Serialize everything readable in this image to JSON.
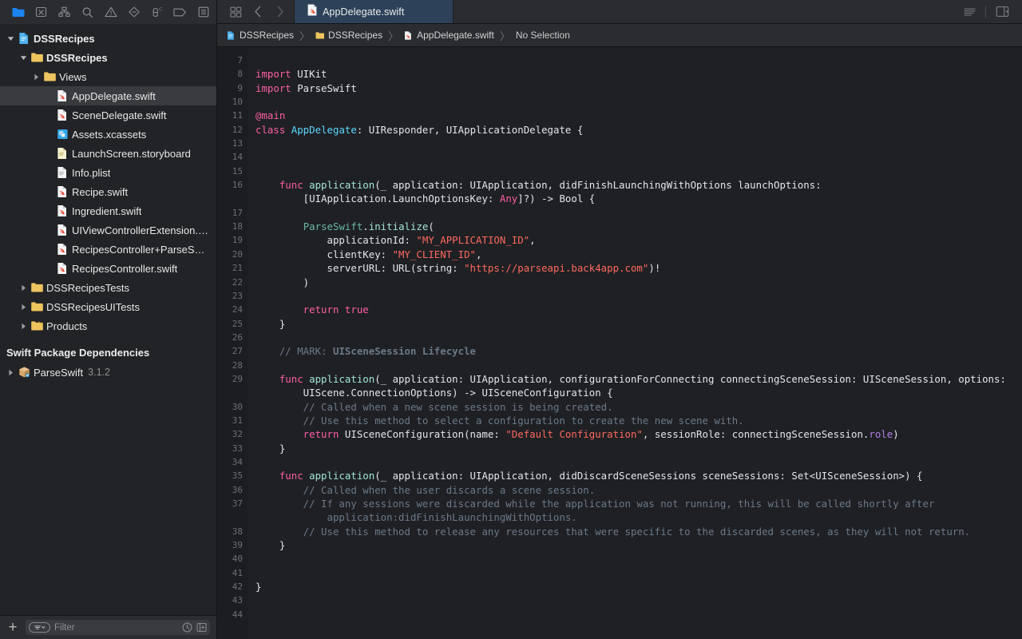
{
  "window": {
    "title": "AppDelegate.swift"
  },
  "navigator_toolbar": {
    "icons": [
      {
        "name": "project-navigator-icon",
        "label": "Project"
      },
      {
        "name": "source-control-navigator-icon",
        "label": "Source Control"
      },
      {
        "name": "symbol-navigator-icon",
        "label": "Symbols"
      },
      {
        "name": "find-navigator-icon",
        "label": "Find"
      },
      {
        "name": "issue-navigator-icon",
        "label": "Issues"
      },
      {
        "name": "test-navigator-icon",
        "label": "Tests"
      },
      {
        "name": "debug-navigator-icon",
        "label": "Debug"
      },
      {
        "name": "breakpoint-navigator-icon",
        "label": "Breakpoints"
      },
      {
        "name": "report-navigator-icon",
        "label": "Reports"
      }
    ]
  },
  "editor_toolbar": {
    "grid_button": "grid-view-icon",
    "back_button": "chevron-left-icon",
    "forward_button": "chevron-right-icon",
    "minimap_button": "minimap-icon",
    "inspector_button": "inspector-toggle-icon"
  },
  "tabs": [
    {
      "label": "AppDelegate.swift",
      "icon": "swift-file-icon",
      "active": true
    }
  ],
  "breadcrumb": [
    {
      "label": "DSSRecipes",
      "icon": "project-icon"
    },
    {
      "label": "DSSRecipes",
      "icon": "folder-icon"
    },
    {
      "label": "AppDelegate.swift",
      "icon": "swift-file-icon"
    },
    {
      "label": "No Selection",
      "icon": null
    }
  ],
  "navigator": {
    "tree": [
      {
        "label": "DSSRecipes",
        "icon": "project-icon",
        "indent": 0,
        "twisty": "down",
        "bold": true,
        "selected": false
      },
      {
        "label": "DSSRecipes",
        "icon": "folder-icon",
        "indent": 1,
        "twisty": "down",
        "bold": true,
        "selected": false
      },
      {
        "label": "Views",
        "icon": "folder-icon",
        "indent": 2,
        "twisty": "right",
        "bold": false,
        "selected": false
      },
      {
        "label": "AppDelegate.swift",
        "icon": "swift-file-icon",
        "indent": 3,
        "twisty": "none",
        "bold": false,
        "selected": true
      },
      {
        "label": "SceneDelegate.swift",
        "icon": "swift-file-icon",
        "indent": 3,
        "twisty": "none",
        "bold": false,
        "selected": false
      },
      {
        "label": "Assets.xcassets",
        "icon": "assets-icon",
        "indent": 3,
        "twisty": "none",
        "bold": false,
        "selected": false
      },
      {
        "label": "LaunchScreen.storyboard",
        "icon": "storyboard-icon",
        "indent": 3,
        "twisty": "none",
        "bold": false,
        "selected": false
      },
      {
        "label": "Info.plist",
        "icon": "plist-icon",
        "indent": 3,
        "twisty": "none",
        "bold": false,
        "selected": false
      },
      {
        "label": "Recipe.swift",
        "icon": "swift-file-icon",
        "indent": 3,
        "twisty": "none",
        "bold": false,
        "selected": false
      },
      {
        "label": "Ingredient.swift",
        "icon": "swift-file-icon",
        "indent": 3,
        "twisty": "none",
        "bold": false,
        "selected": false
      },
      {
        "label": "UIViewControllerExtension.s…",
        "icon": "swift-file-icon",
        "indent": 3,
        "twisty": "none",
        "bold": false,
        "selected": false
      },
      {
        "label": "RecipesController+ParseSwift…",
        "icon": "swift-file-icon",
        "indent": 3,
        "twisty": "none",
        "bold": false,
        "selected": false
      },
      {
        "label": "RecipesController.swift",
        "icon": "swift-file-icon",
        "indent": 3,
        "twisty": "none",
        "bold": false,
        "selected": false
      },
      {
        "label": "DSSRecipesTests",
        "icon": "folder-icon",
        "indent": 1,
        "twisty": "right",
        "bold": false,
        "selected": false
      },
      {
        "label": "DSSRecipesUITests",
        "icon": "folder-icon",
        "indent": 1,
        "twisty": "right",
        "bold": false,
        "selected": false
      },
      {
        "label": "Products",
        "icon": "folder-products-icon",
        "indent": 1,
        "twisty": "right",
        "bold": false,
        "selected": false
      }
    ],
    "packages_section_title": "Swift Package Dependencies",
    "packages": [
      {
        "label": "ParseSwift",
        "version": "3.1.2",
        "icon": "package-icon",
        "indent": 0,
        "twisty": "right"
      }
    ],
    "footer": {
      "add_label": "+",
      "filter_placeholder": "Filter",
      "recent_icon": "clock-icon",
      "sourcecontrol_icon": "filter-scm-icon"
    }
  },
  "editor": {
    "first_line_number": 7,
    "last_line_number": 44,
    "lines": [
      {
        "n": 7,
        "tokens": []
      },
      {
        "n": 8,
        "tokens": [
          {
            "t": "import ",
            "c": "kw"
          },
          {
            "t": "UIKit",
            "c": "plain"
          }
        ]
      },
      {
        "n": 9,
        "tokens": [
          {
            "t": "import ",
            "c": "kw"
          },
          {
            "t": "ParseSwift",
            "c": "plain"
          }
        ]
      },
      {
        "n": 10,
        "tokens": []
      },
      {
        "n": 11,
        "tokens": [
          {
            "t": "@main",
            "c": "attr"
          }
        ]
      },
      {
        "n": 12,
        "tokens": [
          {
            "t": "class ",
            "c": "kw"
          },
          {
            "t": "AppDelegate",
            "c": "tdef"
          },
          {
            "t": ": UIResponder, UIApplicationDelegate {",
            "c": "plain"
          }
        ]
      },
      {
        "n": 13,
        "tokens": []
      },
      {
        "n": 14,
        "tokens": []
      },
      {
        "n": 15,
        "tokens": []
      },
      {
        "n": 16,
        "tokens": [
          {
            "t": "    func ",
            "c": "kw"
          },
          {
            "t": "application",
            "c": "meth"
          },
          {
            "t": "(_ application: UIApplication, didFinishLaunchingWithOptions launchOptions:",
            "c": "plain"
          }
        ]
      },
      {
        "n": null,
        "tokens": [
          {
            "t": "        [UIApplication.LaunchOptionsKey: ",
            "c": "plain"
          },
          {
            "t": "Any",
            "c": "kw"
          },
          {
            "t": "]?) -> Bool {",
            "c": "plain"
          }
        ]
      },
      {
        "n": 17,
        "tokens": []
      },
      {
        "n": 18,
        "tokens": [
          {
            "t": "        ",
            "c": "plain"
          },
          {
            "t": "ParseSwift",
            "c": "fn"
          },
          {
            "t": ".",
            "c": "plain"
          },
          {
            "t": "initialize",
            "c": "meth"
          },
          {
            "t": "(",
            "c": "plain"
          }
        ]
      },
      {
        "n": 19,
        "tokens": [
          {
            "t": "            applicationId: ",
            "c": "plain"
          },
          {
            "t": "\"MY_APPLICATION_ID\"",
            "c": "str"
          },
          {
            "t": ",",
            "c": "plain"
          }
        ]
      },
      {
        "n": 20,
        "tokens": [
          {
            "t": "            clientKey: ",
            "c": "plain"
          },
          {
            "t": "\"MY_CLIENT_ID\"",
            "c": "str"
          },
          {
            "t": ",",
            "c": "plain"
          }
        ]
      },
      {
        "n": 21,
        "tokens": [
          {
            "t": "            serverURL: URL(string: ",
            "c": "plain"
          },
          {
            "t": "\"https://parseapi.back4app.com\"",
            "c": "str"
          },
          {
            "t": ")!",
            "c": "plain"
          }
        ]
      },
      {
        "n": 22,
        "tokens": [
          {
            "t": "        )",
            "c": "plain"
          }
        ]
      },
      {
        "n": 23,
        "tokens": []
      },
      {
        "n": 24,
        "tokens": [
          {
            "t": "        return true",
            "c": "kw"
          }
        ]
      },
      {
        "n": 25,
        "tokens": [
          {
            "t": "    }",
            "c": "plain"
          }
        ]
      },
      {
        "n": 26,
        "tokens": []
      },
      {
        "n": 27,
        "tokens": [
          {
            "t": "    // MARK: ",
            "c": "com"
          },
          {
            "t": "UISceneSession Lifecycle",
            "c": "comk"
          }
        ]
      },
      {
        "n": 28,
        "tokens": []
      },
      {
        "n": 29,
        "tokens": [
          {
            "t": "    func ",
            "c": "kw"
          },
          {
            "t": "application",
            "c": "meth"
          },
          {
            "t": "(_ application: UIApplication, configurationForConnecting connectingSceneSession: UISceneSession, options:",
            "c": "plain"
          }
        ]
      },
      {
        "n": null,
        "tokens": [
          {
            "t": "        UIScene.ConnectionOptions) -> UISceneConfiguration {",
            "c": "plain"
          }
        ]
      },
      {
        "n": 30,
        "tokens": [
          {
            "t": "        // Called when a new scene session is being created.",
            "c": "com"
          }
        ]
      },
      {
        "n": 31,
        "tokens": [
          {
            "t": "        // Use this method to select a configuration to create the new scene with.",
            "c": "com"
          }
        ]
      },
      {
        "n": 32,
        "tokens": [
          {
            "t": "        return ",
            "c": "kw"
          },
          {
            "t": "UISceneConfiguration(name: ",
            "c": "plain"
          },
          {
            "t": "\"Default Configuration\"",
            "c": "str"
          },
          {
            "t": ", sessionRole: connectingSceneSession.",
            "c": "plain"
          },
          {
            "t": "role",
            "c": "prop"
          },
          {
            "t": ")",
            "c": "plain"
          }
        ]
      },
      {
        "n": 33,
        "tokens": [
          {
            "t": "    }",
            "c": "plain"
          }
        ]
      },
      {
        "n": 34,
        "tokens": []
      },
      {
        "n": 35,
        "tokens": [
          {
            "t": "    func ",
            "c": "kw"
          },
          {
            "t": "application",
            "c": "meth"
          },
          {
            "t": "(_ application: UIApplication, didDiscardSceneSessions sceneSessions: Set<UISceneSession>) {",
            "c": "plain"
          }
        ]
      },
      {
        "n": 36,
        "tokens": [
          {
            "t": "        // Called when the user discards a scene session.",
            "c": "com"
          }
        ]
      },
      {
        "n": 37,
        "tokens": [
          {
            "t": "        // If any sessions were discarded while the application was not running, this will be called shortly after",
            "c": "com"
          }
        ]
      },
      {
        "n": null,
        "tokens": [
          {
            "t": "            application:didFinishLaunchingWithOptions.",
            "c": "com"
          }
        ]
      },
      {
        "n": 38,
        "tokens": [
          {
            "t": "        // Use this method to release any resources that were specific to the discarded scenes, as they will not return.",
            "c": "com"
          }
        ]
      },
      {
        "n": 39,
        "tokens": [
          {
            "t": "    }",
            "c": "plain"
          }
        ]
      },
      {
        "n": 40,
        "tokens": []
      },
      {
        "n": 41,
        "tokens": []
      },
      {
        "n": 42,
        "tokens": [
          {
            "t": "}",
            "c": "plain"
          }
        ]
      },
      {
        "n": 43,
        "tokens": []
      },
      {
        "n": 44,
        "tokens": []
      }
    ]
  },
  "colors": {
    "editor_background": "#1f2024",
    "gutter_background": "#1c1d21",
    "sidebar_background": "#222326",
    "toolbar_background": "#2b2c30",
    "active_tab_background": "#2d4259",
    "selection_background": "#3a3b3f",
    "keyword": "#fc5fa3",
    "string": "#fc6a5d",
    "comment": "#6c7986",
    "type_declaration": "#5dd8ff",
    "function_name": "#67b7a4",
    "method": "#a0e6d4",
    "property": "#b281eb",
    "plain_text": "#e4e5ea"
  }
}
